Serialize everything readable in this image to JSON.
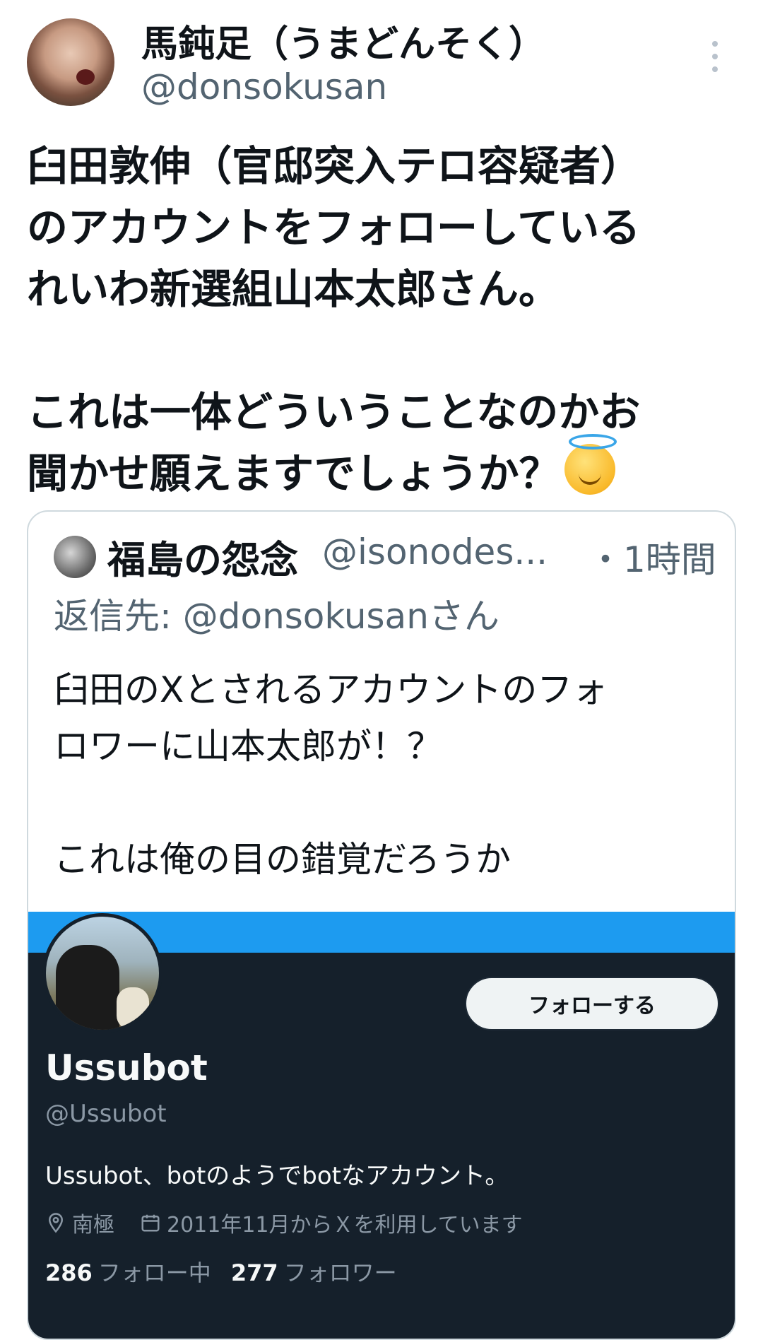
{
  "author": {
    "display_name": "馬鈍足（うまどんそく）",
    "handle": "@donsokusan"
  },
  "tweet": {
    "lines": [
      "臼田敦伸（官邸突入テロ容疑者）",
      "のアカウントをフォローしている",
      "れいわ新選組山本太郎さん。",
      "これは一体どういうことなのかお",
      "聞かせ願えますでしょうか？"
    ],
    "emoji": "smiling-face-with-halo"
  },
  "quote": {
    "display_name": "福島の怨念",
    "handle": "@isonodes...",
    "time": "・1時間",
    "reply_to": "返信先: @donsokusanさん",
    "lines": [
      "臼田のXとされるアカウントのフォ",
      "ロワーに山本太郎が！？",
      "これは俺の目の錯覚だろうか"
    ]
  },
  "profile": {
    "follow_label": "フォローする",
    "name": "Ussubot",
    "handle": "@Ussubot",
    "bio": "Ussubot、botのようでbotなアカウント。",
    "location": "南極",
    "joined": "2011年11月からＸを利用しています",
    "following_count": "286",
    "following_label": "フォロー中",
    "followers_count": "277",
    "followers_label": "フォロワー",
    "banner_color": "#1d9bf0",
    "background_color": "#15202b"
  }
}
